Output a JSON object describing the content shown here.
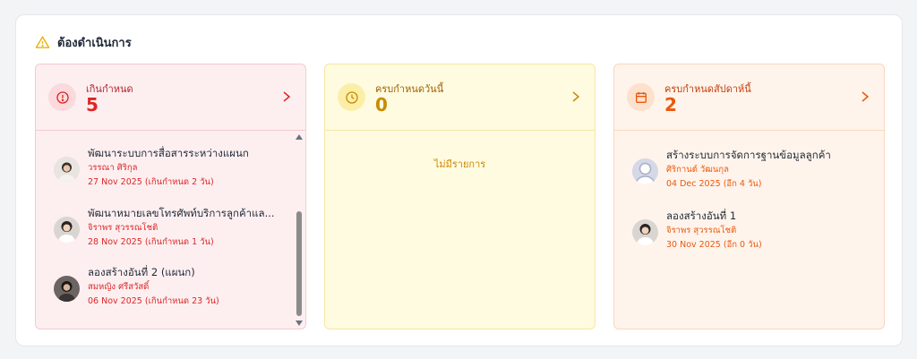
{
  "header": {
    "title": "ต้องดำเนินการ",
    "icon": "warning-triangle-icon"
  },
  "colors": {
    "overdue": "#dc2626",
    "today": "#ca8a04",
    "week": "#ea580c"
  },
  "cards": {
    "overdue": {
      "label": "เกินกำหนด",
      "count": "5",
      "icon": "alert-circle-icon",
      "items": [
        {
          "title": "พัฒนาระบบการสื่อสารระหว่างแผนก",
          "person": "วรรณา ศิริกุล",
          "date": "27 Nov 2025 (เกินกำหนด 2 วัน)"
        },
        {
          "title": "พัฒนาหมายเลขโทรศัพท์บริการลูกค้าแล...",
          "person": "จิราพร สุวรรณโชติ",
          "date": "28 Nov 2025 (เกินกำหนด 1 วัน)"
        },
        {
          "title": "ลองสร้างอันที่ 2 (แผนก)",
          "person": "สมหญิง ศรีสวัสดิ์",
          "date": "06 Nov 2025 (เกินกำหนด 23 วัน)"
        }
      ]
    },
    "today": {
      "label": "ครบกำหนดวันนี้",
      "count": "0",
      "icon": "clock-icon",
      "empty_text": "ไม่มีรายการ"
    },
    "week": {
      "label": "ครบกำหนดสัปดาห์นี้",
      "count": "2",
      "icon": "calendar-icon",
      "items": [
        {
          "title": "สร้างระบบการจัดการฐานข้อมูลลูกค้า",
          "person": "ศิริกานต์ วัฒนกุล",
          "date": "04 Dec 2025 (อีก 4 วัน)"
        },
        {
          "title": "ลองสร้างอันที่ 1",
          "person": "จิราพร สุวรรณโชติ",
          "date": "30 Nov 2025 (อีก 0 วัน)"
        }
      ]
    }
  }
}
